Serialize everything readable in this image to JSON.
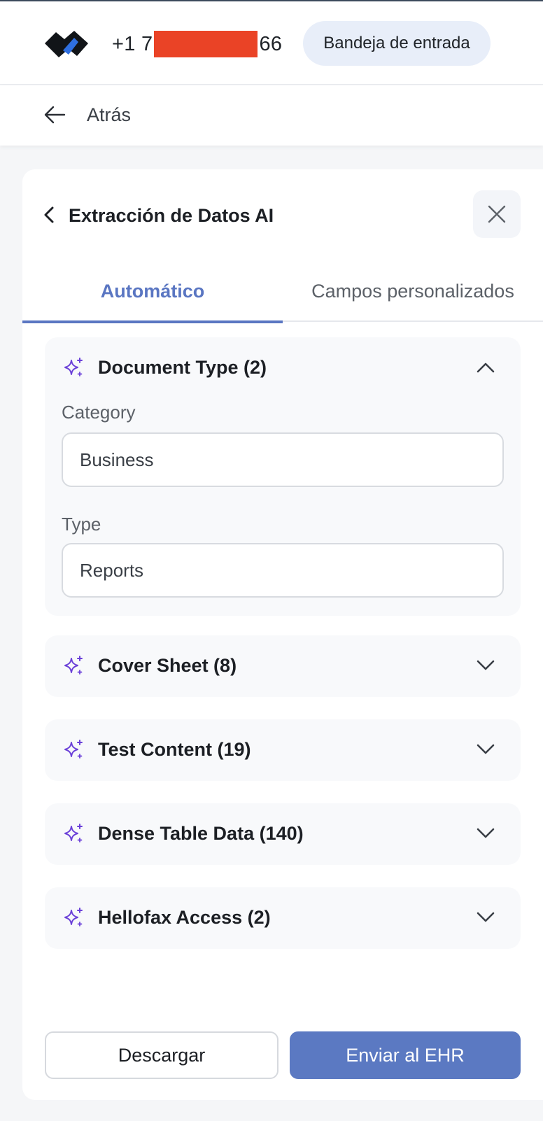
{
  "header": {
    "logo": "app-logo",
    "phone_prefix": "+1 7",
    "phone_suffix": "66",
    "inbox_label": "Bandeja de entrada"
  },
  "nav": {
    "back_icon": "arrow-left-icon",
    "back_label": "Atrás"
  },
  "panel": {
    "title": "Extracción de Datos AI",
    "back_icon": "chevron-left-icon",
    "close_icon": "close-icon",
    "tabs": [
      {
        "label": "Automático",
        "active": true
      },
      {
        "label": "Campos personalizados",
        "active": false
      }
    ],
    "sections": [
      {
        "title": "Document Type (2)",
        "icon": "sparkle-icon",
        "expanded": true,
        "fields": [
          {
            "label": "Category",
            "value": "Business"
          },
          {
            "label": "Type",
            "value": "Reports"
          }
        ]
      },
      {
        "title": "Cover Sheet (8)",
        "icon": "sparkle-icon",
        "expanded": false
      },
      {
        "title": "Test Content (19)",
        "icon": "sparkle-icon",
        "expanded": false
      },
      {
        "title": "Dense Table Data (140)",
        "icon": "sparkle-icon",
        "expanded": false
      },
      {
        "title": "Hellofax Access (2)",
        "icon": "sparkle-icon",
        "expanded": false
      }
    ],
    "actions": {
      "download_label": "Descargar",
      "send_label": "Enviar al EHR"
    }
  },
  "colors": {
    "accent": "#5a76c2",
    "sparkle": "#6a3fd8",
    "redaction": "#ea4326",
    "pill_bg": "#e8eef9"
  }
}
